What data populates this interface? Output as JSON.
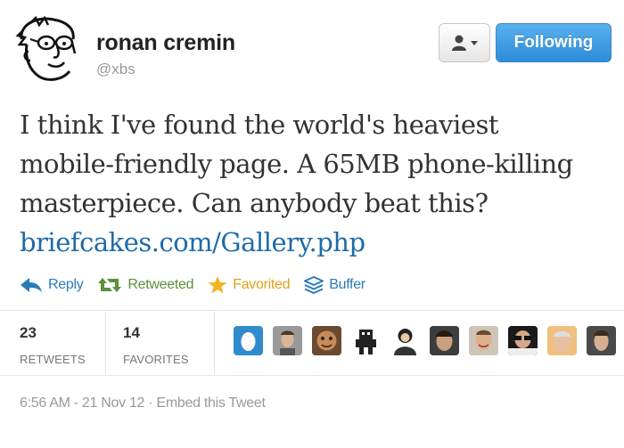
{
  "author": {
    "name": "ronan cremin",
    "handle": "@xbs",
    "avatar_icon": "sketch-face-avatar-icon"
  },
  "header_buttons": {
    "user_menu_icon": "person-dropdown-icon",
    "follow_label": "Following",
    "follow_color": "#2d8cd7"
  },
  "tweet": {
    "lines": [
      "I think I've found the world's heaviest",
      "mobile-friendly page. A 65MB phone-killing",
      "masterpiece. Can anybody beat this?"
    ],
    "link": "briefcakes.com/Gallery.php",
    "link_color": "#1f6ba7"
  },
  "actions": {
    "reply": "Reply",
    "retweeted": "Retweeted",
    "favorited": "Favorited",
    "buffer": "Buffer"
  },
  "stats": {
    "retweets_count": "23",
    "retweets_label": "RETWEETS",
    "favorites_count": "14",
    "favorites_label": "FAVORITES"
  },
  "favoriter_avatars": [
    "egg-avatar",
    "man-avatar",
    "cartoon-avatar",
    "robot-avatar",
    "character-avatar",
    "face-avatar",
    "smiling-man-avatar",
    "sunglasses-avatar",
    "older-man-avatar",
    "young-man-avatar"
  ],
  "meta": {
    "timestamp": "6:56 AM - 21 Nov 12",
    "separator": "·",
    "embed": "Embed this Tweet"
  }
}
